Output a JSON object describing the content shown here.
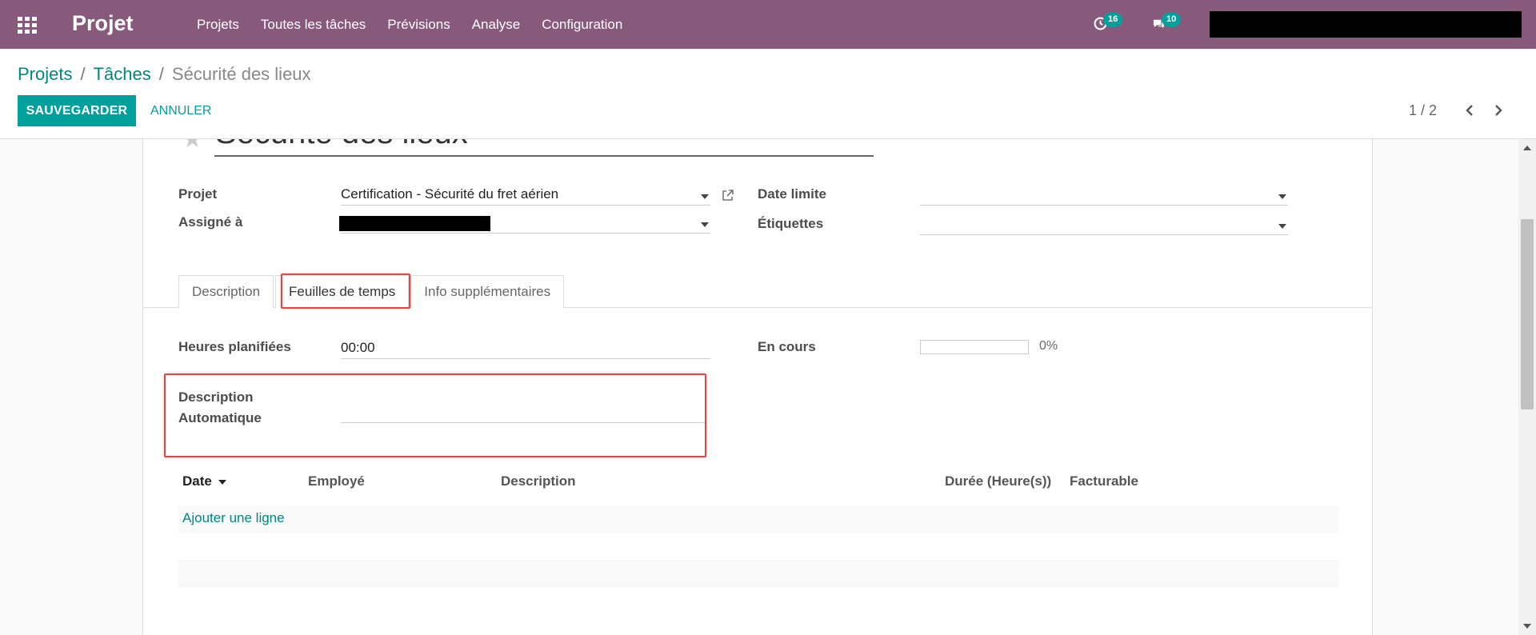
{
  "navbar": {
    "brand": "Projet",
    "menu": [
      "Projets",
      "Toutes les tâches",
      "Prévisions",
      "Analyse",
      "Configuration"
    ],
    "activity_count": "16",
    "messages_count": "10",
    "color": "#875a7b"
  },
  "breadcrumb": {
    "items": [
      "Projets",
      "Tâches"
    ],
    "current": "Sécurité des lieux",
    "separator": "/"
  },
  "actions": {
    "save_label": "SAUVEGARDER",
    "cancel_label": "ANNULER"
  },
  "pager": {
    "value": "1 / 2"
  },
  "form": {
    "title": "Sécurité des lieux",
    "fields": {
      "project_label": "Projet",
      "project_value": "Certification - Sécurité du fret aérien",
      "assigned_label": "Assigné à",
      "deadline_label": "Date limite",
      "tags_label": "Étiquettes"
    },
    "tabs": [
      "Description",
      "Feuilles de temps",
      "Info supplémentaires"
    ],
    "active_tab": "Feuilles de temps",
    "timesheets": {
      "planned_hours_label": "Heures planifiées",
      "planned_hours_value": "00:00",
      "in_progress_label": "En cours",
      "progress_percent": 0,
      "progress_text": "0%",
      "auto_desc_label_1": "Description",
      "auto_desc_label_2": "Automatique",
      "columns": [
        "Date",
        "Employé",
        "Description",
        "Durée (Heure(s))",
        "Facturable"
      ],
      "add_line": "Ajouter une ligne"
    }
  },
  "colors": {
    "accent": "#00a09d",
    "link": "#00877f",
    "highlight": "#e04848"
  }
}
